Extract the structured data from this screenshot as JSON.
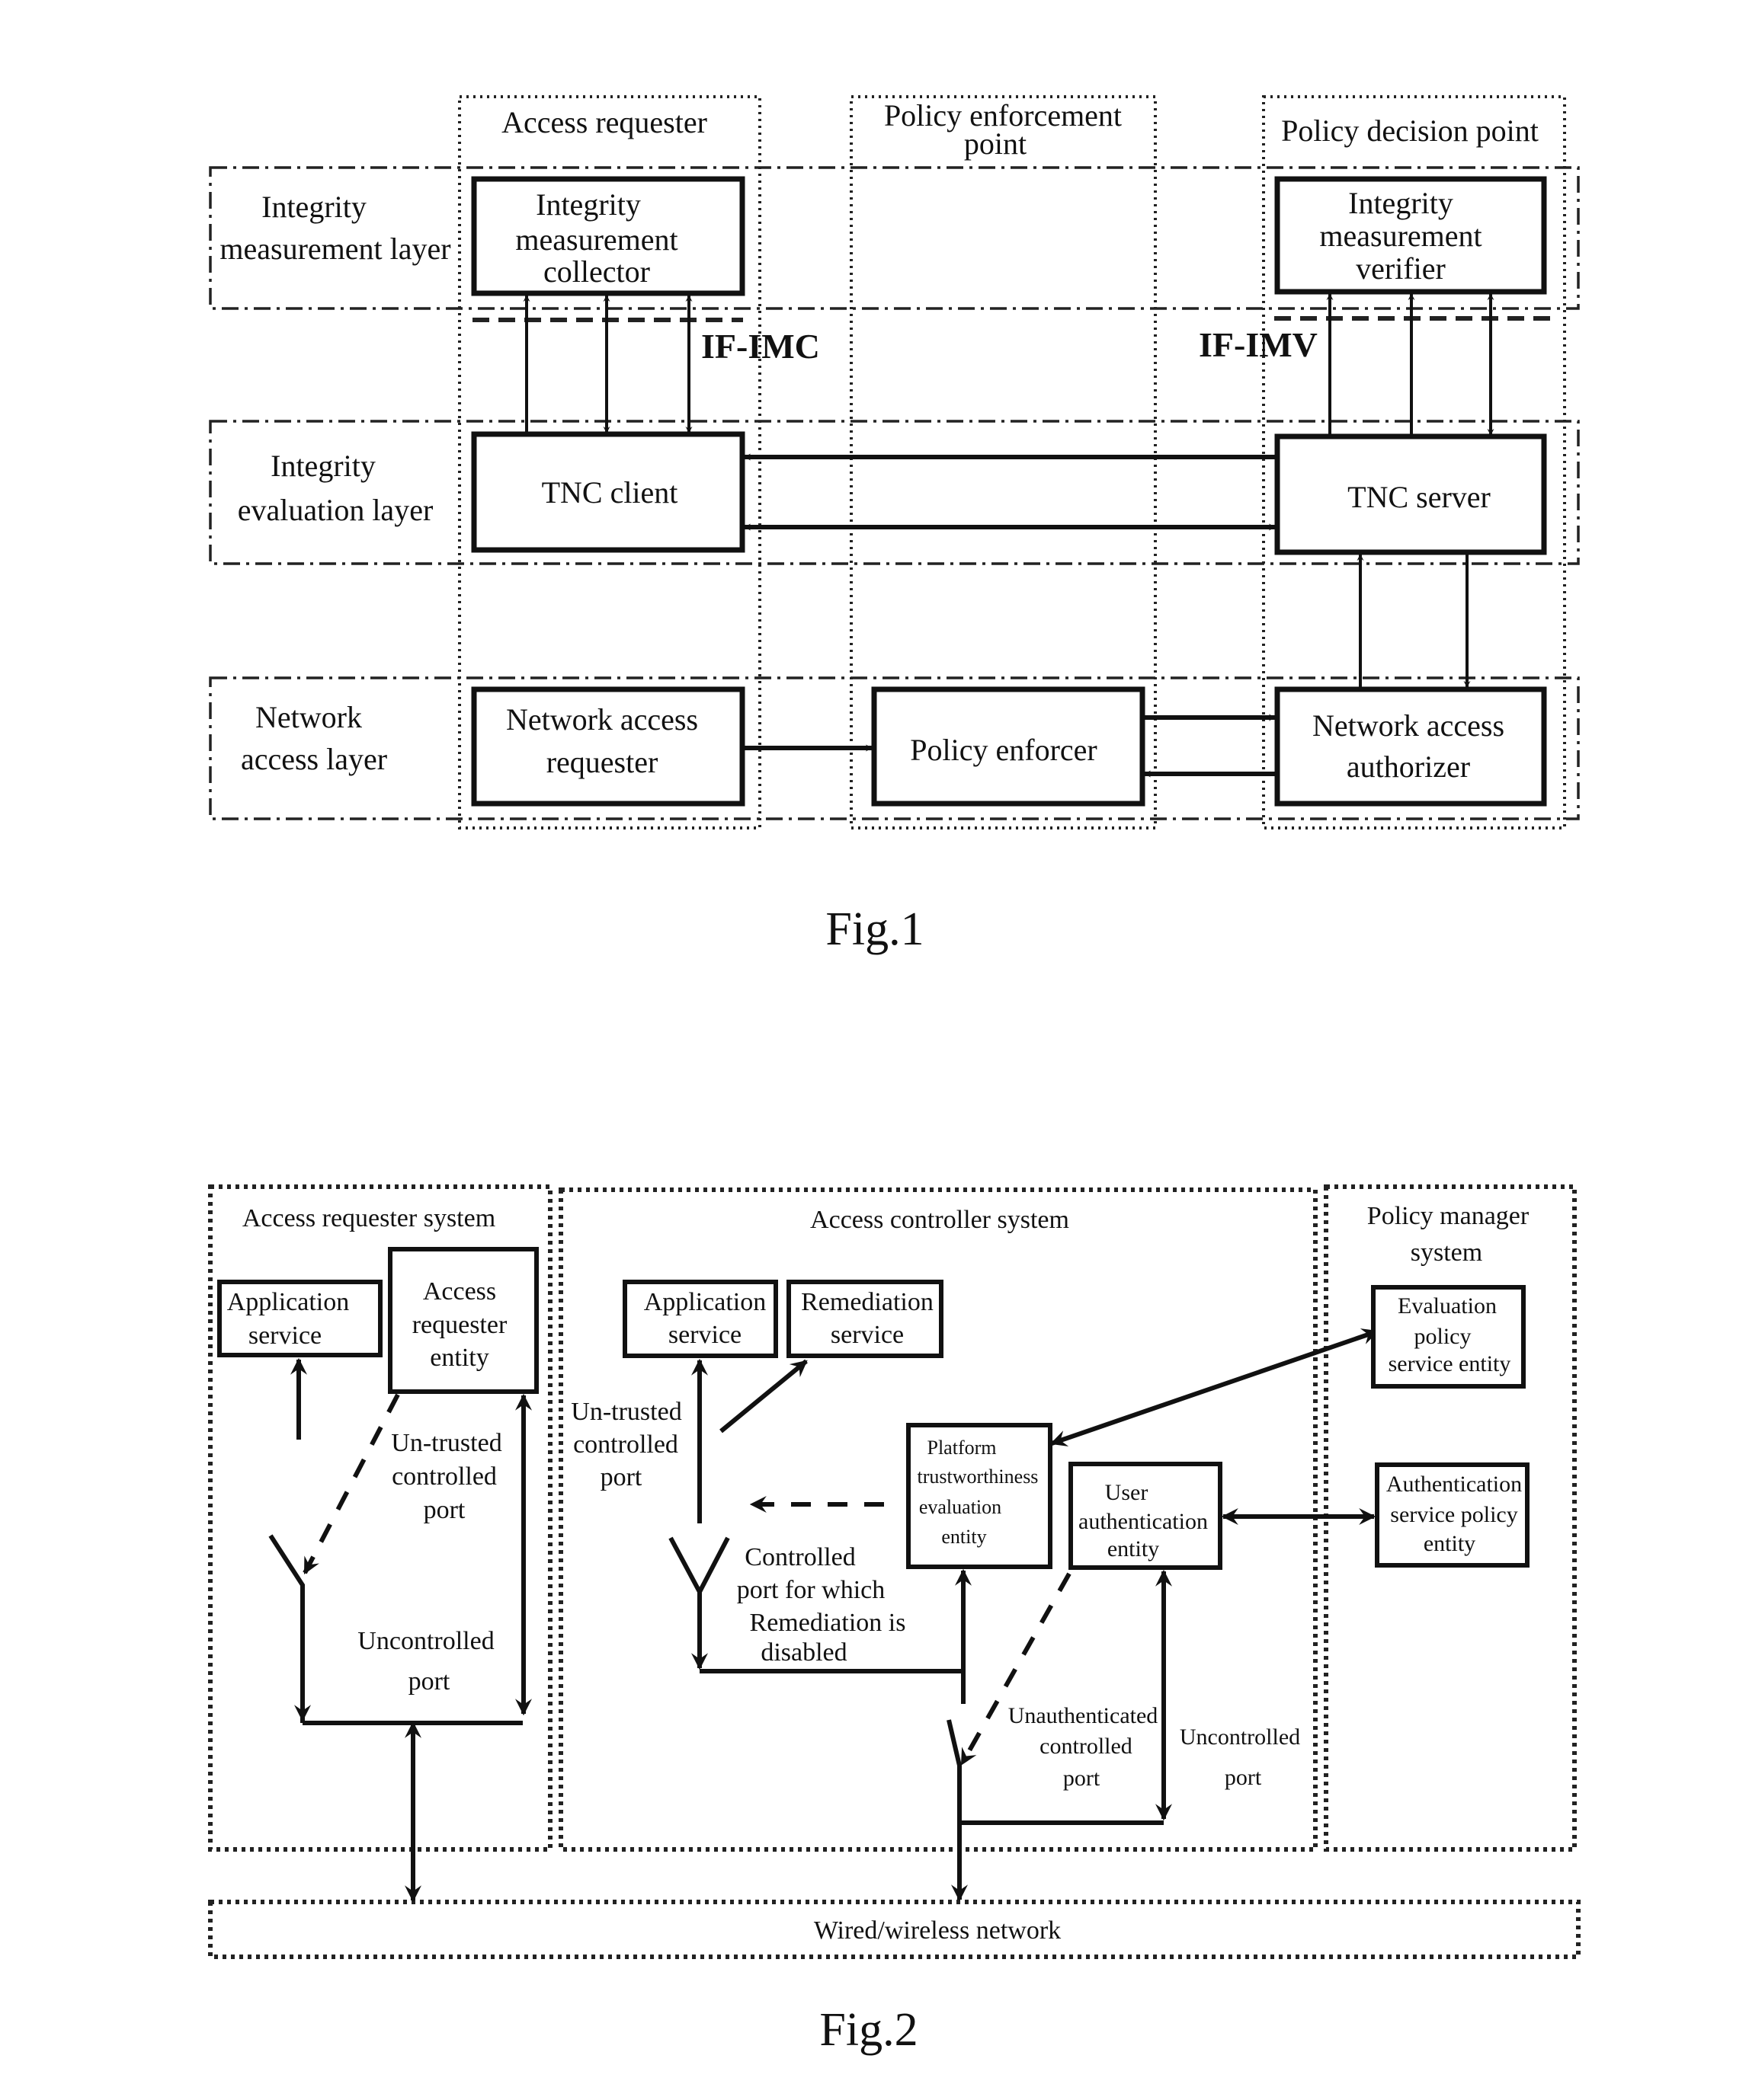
{
  "fig1": {
    "caption": "Fig.1",
    "columns": {
      "access_requester": "Access requester",
      "policy_enforcement_point": [
        "Policy enforcement",
        "point"
      ],
      "policy_decision_point": "Policy decision point"
    },
    "layers": {
      "integrity_measurement": [
        "Integrity",
        "measurement layer"
      ],
      "integrity_evaluation": [
        "Integrity",
        "evaluation layer"
      ],
      "network_access": [
        "Network",
        "access layer"
      ]
    },
    "boxes": {
      "imc": [
        "Integrity",
        "measurement",
        "collector"
      ],
      "imv": [
        "Integrity",
        "measurement",
        "verifier"
      ],
      "tnc_client": "TNC client",
      "tnc_server": "TNC server",
      "nar": [
        "Network access",
        "requester"
      ],
      "pe": "Policy enforcer",
      "naa": [
        "Network access",
        "authorizer"
      ]
    },
    "interfaces": {
      "if_imc": "IF-IMC",
      "if_imv": "IF-IMV"
    }
  },
  "fig2": {
    "caption": "Fig.2",
    "systems": {
      "ar_system": "Access requester system",
      "ac_system": "Access controller system",
      "pm_system": [
        "Policy manager",
        "system"
      ]
    },
    "boxes": {
      "ar_app": [
        "Application",
        "service"
      ],
      "ar_entity": [
        "Access",
        "requester",
        "entity"
      ],
      "ac_app": [
        "Application",
        "service"
      ],
      "remediation": [
        "Remediation",
        "service"
      ],
      "ptee": [
        "Platform",
        "trustworthiness",
        "evaluation",
        "entity"
      ],
      "uae": [
        "User",
        "authentication",
        "entity"
      ],
      "epse": [
        "Evaluation",
        "policy",
        "service entity"
      ],
      "aspe": [
        "Authentication",
        "service policy",
        "entity"
      ]
    },
    "port_labels": {
      "ar_untrusted": [
        "Un-trusted",
        "controlled",
        "port"
      ],
      "ar_uncontrolled": [
        "Uncontrolled",
        "port"
      ],
      "ac_untrusted": [
        "Un-trusted",
        "controlled",
        "port"
      ],
      "ac_controlled_remediation": [
        "Controlled",
        "port for which",
        "Remediation is",
        "disabled"
      ],
      "ac_unauth": [
        "Unauthenticated",
        "controlled",
        "port"
      ],
      "ac_uncontrolled": [
        "Uncontrolled",
        "port"
      ]
    },
    "network": "Wired/wireless network"
  }
}
